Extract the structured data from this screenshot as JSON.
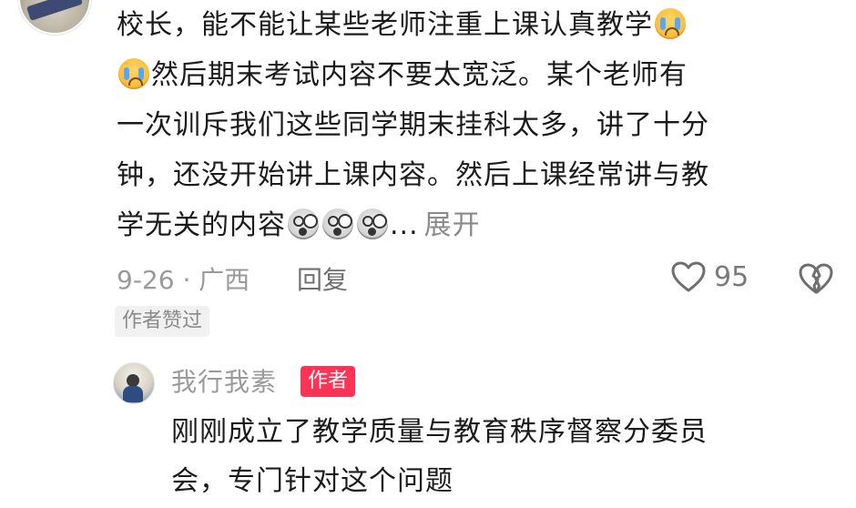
{
  "comment": {
    "lines": [
      "校长，能不能让某些老师注重上课认真教学",
      "然后期末考试内容不要太宽泛。某个老师有",
      "一次训斥我们这些同学期末挂科太多，讲了十分",
      "钟，还没开始讲上课内容。然后上课经常讲与教",
      "学无关的内容"
    ],
    "ellipsis": "...",
    "expand_label": "展开",
    "emojis": [
      "loudly-crying-face",
      "loudly-crying-face",
      "shocked-face",
      "shocked-face",
      "shocked-face"
    ]
  },
  "meta": {
    "date_location": "9-26 · 广西",
    "reply_label": "回复",
    "like_count": "95",
    "author_liked_tag": "作者赞过"
  },
  "reply": {
    "username": "我行我素",
    "badge": "作者",
    "lines": [
      "刚刚成立了教学质量与教育秩序督察分委员",
      "会，专门针对这个问题"
    ]
  },
  "colors": {
    "text": "#1b1b1b",
    "meta_gray": "#9a9a9a",
    "badge_red": "#ff3355",
    "tag_bg": "#f1f1f1"
  },
  "icons": {
    "like": "heart-outline-icon",
    "dislike": "broken-heart-icon"
  }
}
